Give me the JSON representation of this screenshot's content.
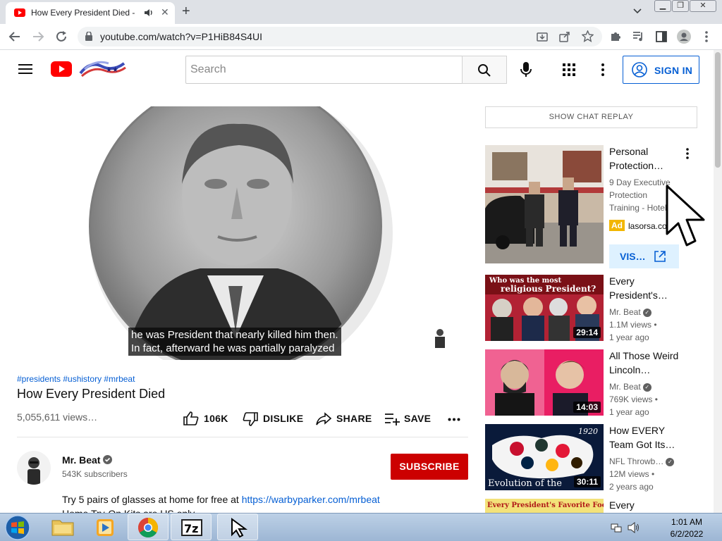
{
  "browser": {
    "tab_title": "How Every President Died -",
    "url": "youtube.com/watch?v=P1HiB84S4UI"
  },
  "header": {
    "search_placeholder": "Search",
    "sign_in": "SIGN IN"
  },
  "video": {
    "caption_line1": "he was President that nearly killed him then.",
    "caption_line2": "In fact, afterward he was partially paralyzed",
    "hashtags": "#presidents #ushistory #mrbeat",
    "title": "How Every President Died",
    "views": "5,055,611 views…",
    "likes": "106K",
    "dislike": "DISLIKE",
    "share": "SHARE",
    "save": "SAVE"
  },
  "channel": {
    "name": "Mr. Beat",
    "subscribers": "543K subscribers",
    "subscribe": "SUBSCRIBE",
    "desc_text": "Try 5 pairs of glasses at home for free at ",
    "desc_link": "https://warbyparker.com/mrbeat",
    "desc_line2": "Home Try-On Kits are US only"
  },
  "sidebar": {
    "chat_replay": "SHOW CHAT REPLAY",
    "ad": {
      "title_line1": "Personal",
      "title_line2": "Protection…",
      "desc_line1": "9 Day Executive",
      "desc_line2": "Protection",
      "desc_line3": "Training - Hotel…",
      "badge": "Ad",
      "domain": "lasorsa.co",
      "visit": "VIS…"
    },
    "items": [
      {
        "title1": "Every",
        "title2": "President's…",
        "channel": "Mr. Beat",
        "views": "1.1M views •",
        "age": "1 year ago",
        "duration": "29:14",
        "thumb_text1": "Who was the most",
        "thumb_text2": "religious President?"
      },
      {
        "title1": "All Those Weird",
        "title2": "Lincoln…",
        "channel": "Mr. Beat",
        "views": "769K views •",
        "age": "1 year ago",
        "duration": "14:03"
      },
      {
        "title1": "How EVERY",
        "title2": "Team Got Its…",
        "channel": "NFL Throwb…",
        "views": "12M views •",
        "age": "2 years ago",
        "duration": "30:11",
        "thumb_text1": "Evolution of the",
        "thumb_text2": "1920"
      },
      {
        "title1": "Every",
        "thumb_text1": "Every President's Favorite Food"
      }
    ]
  },
  "taskbar": {
    "time": "1:01 AM",
    "date": "6/2/2022"
  }
}
